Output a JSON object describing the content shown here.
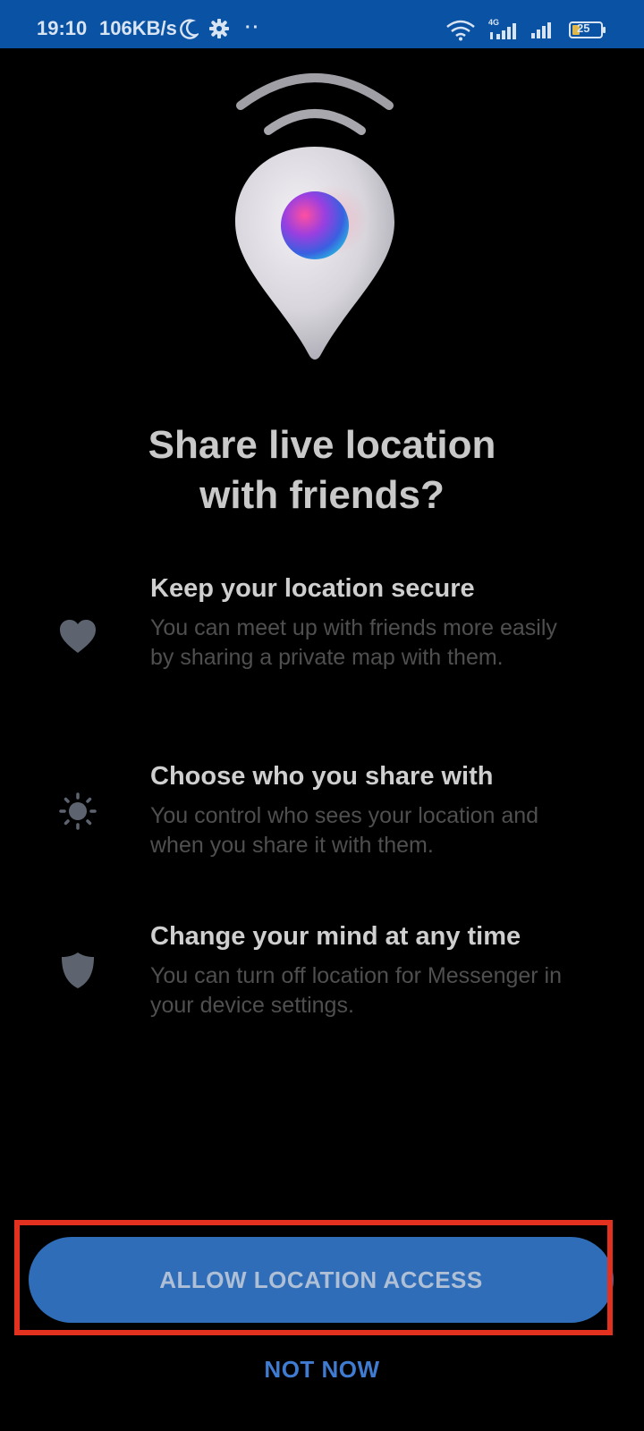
{
  "status_bar": {
    "time": "19:10",
    "speed": "106KB/s",
    "dots": "··",
    "network": "4G",
    "battery": "25"
  },
  "title": {
    "line1": "Share live location",
    "line2": "with friends?"
  },
  "features": [
    {
      "icon": "heart-icon",
      "title": "Keep your location secure",
      "description": "You can meet up with friends more easily by sharing a private map with them."
    },
    {
      "icon": "sun-icon",
      "title": "Choose who you share with",
      "description": "You control who sees your location and when you share it with them."
    },
    {
      "icon": "shield-icon",
      "title": "Change your mind at any time",
      "description": "You can turn off location for Messenger in your device settings."
    }
  ],
  "buttons": {
    "allow": "ALLOW LOCATION ACCESS",
    "not_now": "NOT NOW"
  },
  "colors": {
    "status_bar": "#0a52a3",
    "primary_button": "#2f6db8",
    "link": "#3f7bd0",
    "highlight": "#e2311e",
    "background": "#000000"
  }
}
